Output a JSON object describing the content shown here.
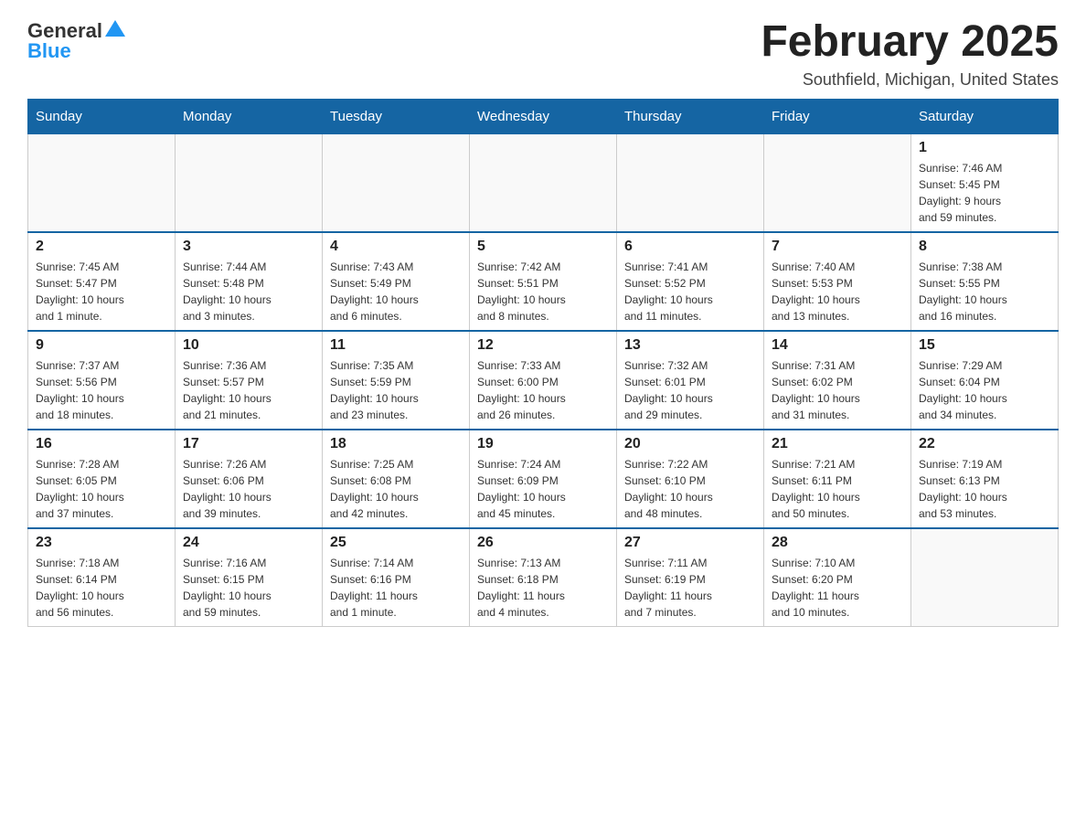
{
  "header": {
    "logo_general": "General",
    "logo_blue": "Blue",
    "month_title": "February 2025",
    "location": "Southfield, Michigan, United States"
  },
  "weekdays": [
    "Sunday",
    "Monday",
    "Tuesday",
    "Wednesday",
    "Thursday",
    "Friday",
    "Saturday"
  ],
  "weeks": [
    [
      {
        "day": "",
        "info": ""
      },
      {
        "day": "",
        "info": ""
      },
      {
        "day": "",
        "info": ""
      },
      {
        "day": "",
        "info": ""
      },
      {
        "day": "",
        "info": ""
      },
      {
        "day": "",
        "info": ""
      },
      {
        "day": "1",
        "info": "Sunrise: 7:46 AM\nSunset: 5:45 PM\nDaylight: 9 hours\nand 59 minutes."
      }
    ],
    [
      {
        "day": "2",
        "info": "Sunrise: 7:45 AM\nSunset: 5:47 PM\nDaylight: 10 hours\nand 1 minute."
      },
      {
        "day": "3",
        "info": "Sunrise: 7:44 AM\nSunset: 5:48 PM\nDaylight: 10 hours\nand 3 minutes."
      },
      {
        "day": "4",
        "info": "Sunrise: 7:43 AM\nSunset: 5:49 PM\nDaylight: 10 hours\nand 6 minutes."
      },
      {
        "day": "5",
        "info": "Sunrise: 7:42 AM\nSunset: 5:51 PM\nDaylight: 10 hours\nand 8 minutes."
      },
      {
        "day": "6",
        "info": "Sunrise: 7:41 AM\nSunset: 5:52 PM\nDaylight: 10 hours\nand 11 minutes."
      },
      {
        "day": "7",
        "info": "Sunrise: 7:40 AM\nSunset: 5:53 PM\nDaylight: 10 hours\nand 13 minutes."
      },
      {
        "day": "8",
        "info": "Sunrise: 7:38 AM\nSunset: 5:55 PM\nDaylight: 10 hours\nand 16 minutes."
      }
    ],
    [
      {
        "day": "9",
        "info": "Sunrise: 7:37 AM\nSunset: 5:56 PM\nDaylight: 10 hours\nand 18 minutes."
      },
      {
        "day": "10",
        "info": "Sunrise: 7:36 AM\nSunset: 5:57 PM\nDaylight: 10 hours\nand 21 minutes."
      },
      {
        "day": "11",
        "info": "Sunrise: 7:35 AM\nSunset: 5:59 PM\nDaylight: 10 hours\nand 23 minutes."
      },
      {
        "day": "12",
        "info": "Sunrise: 7:33 AM\nSunset: 6:00 PM\nDaylight: 10 hours\nand 26 minutes."
      },
      {
        "day": "13",
        "info": "Sunrise: 7:32 AM\nSunset: 6:01 PM\nDaylight: 10 hours\nand 29 minutes."
      },
      {
        "day": "14",
        "info": "Sunrise: 7:31 AM\nSunset: 6:02 PM\nDaylight: 10 hours\nand 31 minutes."
      },
      {
        "day": "15",
        "info": "Sunrise: 7:29 AM\nSunset: 6:04 PM\nDaylight: 10 hours\nand 34 minutes."
      }
    ],
    [
      {
        "day": "16",
        "info": "Sunrise: 7:28 AM\nSunset: 6:05 PM\nDaylight: 10 hours\nand 37 minutes."
      },
      {
        "day": "17",
        "info": "Sunrise: 7:26 AM\nSunset: 6:06 PM\nDaylight: 10 hours\nand 39 minutes."
      },
      {
        "day": "18",
        "info": "Sunrise: 7:25 AM\nSunset: 6:08 PM\nDaylight: 10 hours\nand 42 minutes."
      },
      {
        "day": "19",
        "info": "Sunrise: 7:24 AM\nSunset: 6:09 PM\nDaylight: 10 hours\nand 45 minutes."
      },
      {
        "day": "20",
        "info": "Sunrise: 7:22 AM\nSunset: 6:10 PM\nDaylight: 10 hours\nand 48 minutes."
      },
      {
        "day": "21",
        "info": "Sunrise: 7:21 AM\nSunset: 6:11 PM\nDaylight: 10 hours\nand 50 minutes."
      },
      {
        "day": "22",
        "info": "Sunrise: 7:19 AM\nSunset: 6:13 PM\nDaylight: 10 hours\nand 53 minutes."
      }
    ],
    [
      {
        "day": "23",
        "info": "Sunrise: 7:18 AM\nSunset: 6:14 PM\nDaylight: 10 hours\nand 56 minutes."
      },
      {
        "day": "24",
        "info": "Sunrise: 7:16 AM\nSunset: 6:15 PM\nDaylight: 10 hours\nand 59 minutes."
      },
      {
        "day": "25",
        "info": "Sunrise: 7:14 AM\nSunset: 6:16 PM\nDaylight: 11 hours\nand 1 minute."
      },
      {
        "day": "26",
        "info": "Sunrise: 7:13 AM\nSunset: 6:18 PM\nDaylight: 11 hours\nand 4 minutes."
      },
      {
        "day": "27",
        "info": "Sunrise: 7:11 AM\nSunset: 6:19 PM\nDaylight: 11 hours\nand 7 minutes."
      },
      {
        "day": "28",
        "info": "Sunrise: 7:10 AM\nSunset: 6:20 PM\nDaylight: 11 hours\nand 10 minutes."
      },
      {
        "day": "",
        "info": ""
      }
    ]
  ]
}
